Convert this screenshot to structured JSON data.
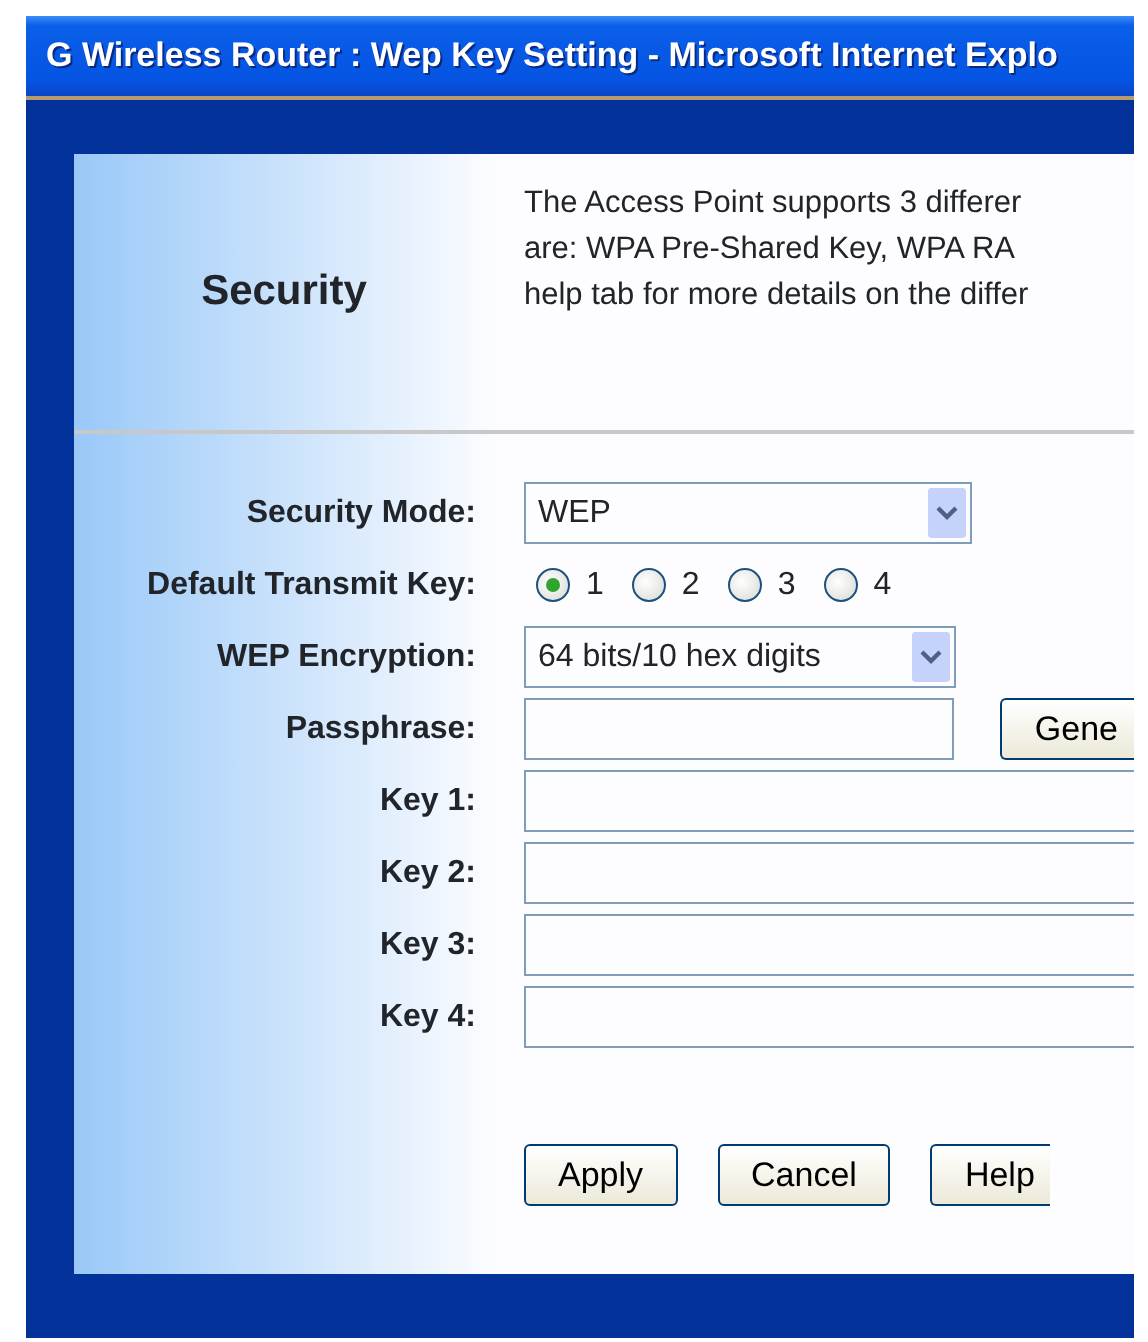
{
  "window": {
    "title": "G Wireless Router : Wep Key Setting - Microsoft Internet Explo"
  },
  "header": {
    "title": "Security",
    "description_lines": [
      "The Access Point supports 3 differer",
      "are: WPA Pre-Shared Key, WPA RA",
      "help tab for more details on the differ"
    ]
  },
  "form": {
    "fields": [
      {
        "kind": "select",
        "label": "Security Mode:",
        "value": "WEP"
      },
      {
        "kind": "radio",
        "label": "Default Transmit Key:",
        "options": [
          {
            "label": "1",
            "selected": true
          },
          {
            "label": "2",
            "selected": false
          },
          {
            "label": "3",
            "selected": false
          },
          {
            "label": "4",
            "selected": false
          }
        ]
      },
      {
        "kind": "select",
        "label": "WEP Encryption:",
        "value": "64 bits/10 hex digits"
      },
      {
        "kind": "text_with_button",
        "label": "Passphrase:",
        "button": "Gene"
      },
      {
        "kind": "text",
        "label": "Key 1:"
      },
      {
        "kind": "text",
        "label": "Key 2:"
      },
      {
        "kind": "text",
        "label": "Key 3:"
      },
      {
        "kind": "text",
        "label": "Key 4:"
      }
    ]
  },
  "buttons": [
    "Apply",
    "Cancel",
    "Help"
  ]
}
